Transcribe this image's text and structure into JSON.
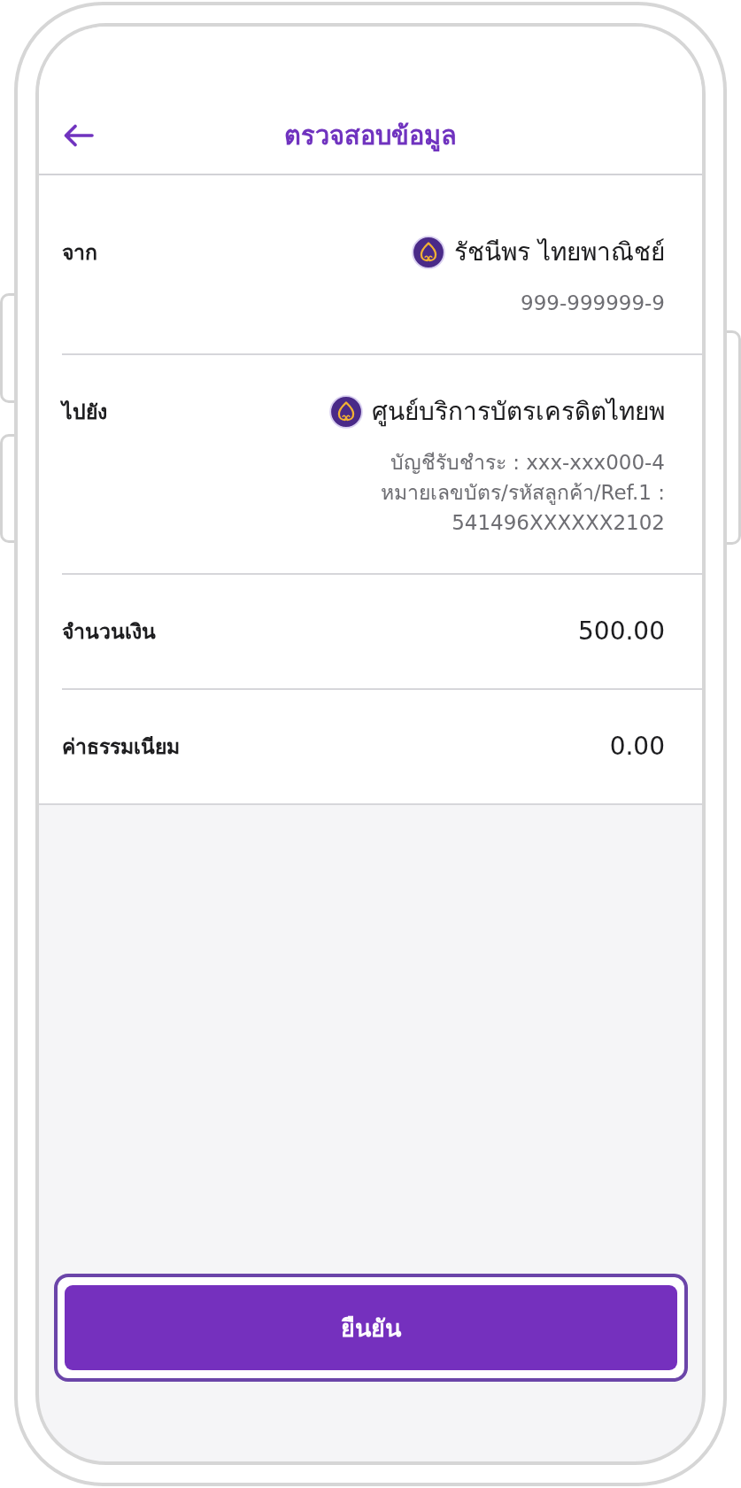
{
  "header": {
    "title": "ตรวจสอบข้อมูล"
  },
  "rows": [
    {
      "kind": "account",
      "label": "จาก",
      "name": "รัชนีพร ไทยพาณิชย์",
      "details": [
        "999-999999-9"
      ]
    },
    {
      "kind": "account",
      "label": "ไปยัง",
      "name": "ศูนย์บริการบัตรเครดิตไทยพ",
      "details": [
        "บัญชีรับชำระ : xxx-xxx000-4",
        "หมายเลขบัตร/รหัสลูกค้า/Ref.1 :",
        "541496XXXXXX2102"
      ]
    },
    {
      "kind": "amount",
      "label": "จำนวนเงิน",
      "value": "500.00"
    },
    {
      "kind": "amount",
      "label": "ค่าธรรมเนียม",
      "value": "0.00"
    }
  ],
  "confirm_button": {
    "label": "ยืนยัน",
    "focused": true
  }
}
